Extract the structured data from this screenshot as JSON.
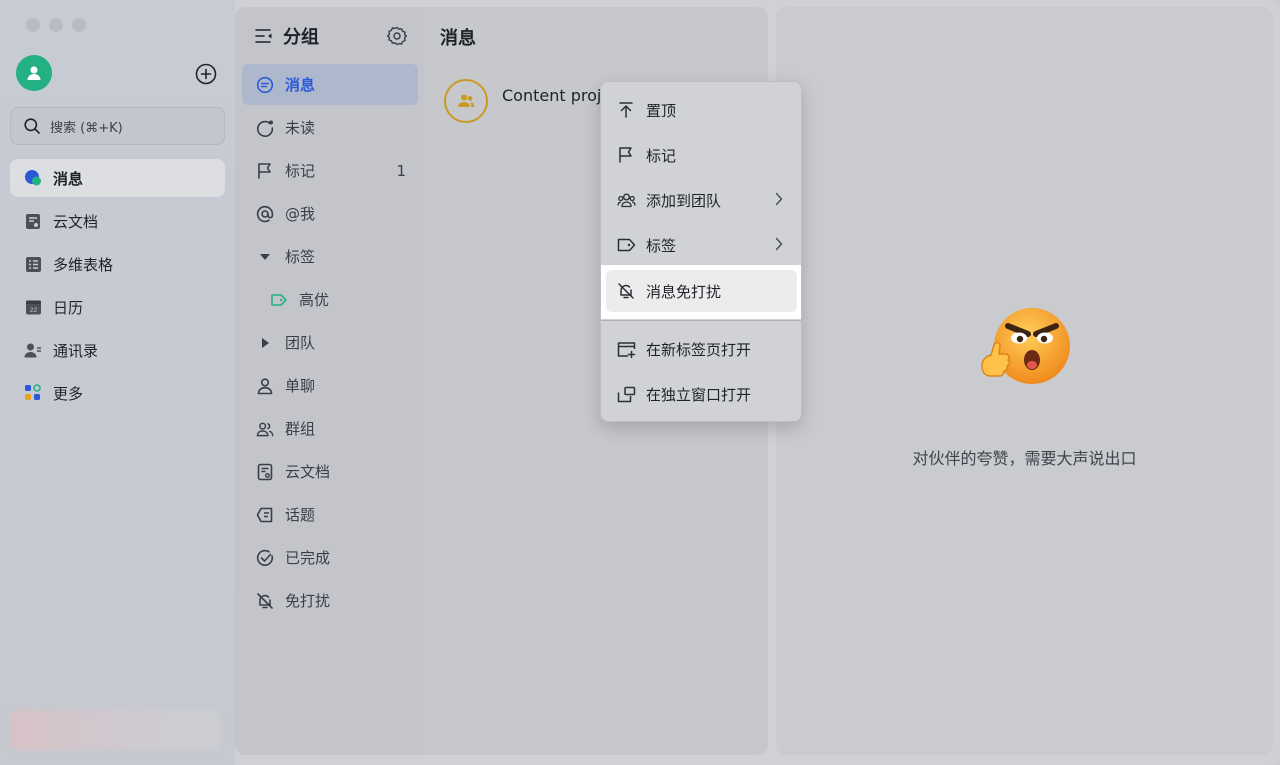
{
  "sidebar": {
    "search_placeholder": "搜索 (⌘+K)",
    "items": [
      {
        "label": "消息",
        "icon": "chat-bubble-icon",
        "active": true
      },
      {
        "label": "云文档",
        "icon": "doc-icon"
      },
      {
        "label": "多维表格",
        "icon": "table-icon"
      },
      {
        "label": "日历",
        "icon": "calendar-icon",
        "calendar_day": "22"
      },
      {
        "label": "通讯录",
        "icon": "contacts-icon"
      },
      {
        "label": "更多",
        "icon": "apps-icon"
      }
    ]
  },
  "groups": {
    "title": "分组",
    "items": [
      {
        "label": "消息",
        "icon": "chat-icon",
        "active": true
      },
      {
        "label": "未读",
        "icon": "unread-icon"
      },
      {
        "label": "标记",
        "icon": "flag-icon",
        "count": "1"
      },
      {
        "label": "@我",
        "icon": "at-icon"
      },
      {
        "label": "标签",
        "icon": "caret-down-icon"
      },
      {
        "label": "高优",
        "icon": "tag-icon",
        "sub": true
      },
      {
        "label": "团队",
        "icon": "caret-right-icon"
      },
      {
        "label": "单聊",
        "icon": "person-icon"
      },
      {
        "label": "群组",
        "icon": "group-icon"
      },
      {
        "label": "云文档",
        "icon": "doc-icon"
      },
      {
        "label": "话题",
        "icon": "topic-icon"
      },
      {
        "label": "已完成",
        "icon": "done-icon"
      },
      {
        "label": "免打扰",
        "icon": "mute-icon"
      }
    ]
  },
  "messages": {
    "title": "消息",
    "chat_name": "Content proje"
  },
  "context_menu": {
    "items": [
      {
        "label": "置顶",
        "icon": "pin-top-icon"
      },
      {
        "label": "标记",
        "icon": "flag-icon"
      },
      {
        "label": "添加到团队",
        "icon": "team-icon",
        "submenu": true
      },
      {
        "label": "标签",
        "icon": "tag-icon",
        "submenu": true
      },
      {
        "label": "消息免打扰",
        "icon": "mute-icon",
        "highlighted": true
      },
      {
        "label": "在新标签页打开",
        "icon": "new-tab-icon"
      },
      {
        "label": "在独立窗口打开",
        "icon": "new-window-icon"
      }
    ]
  },
  "empty_state": {
    "caption": "对伙伴的夸赞，需要大声说出口"
  },
  "colors": {
    "accent": "#2c5ad7",
    "avatar_green": "#23b083",
    "tag_green": "#23b083",
    "chat_avatar_ring": "#c99a25"
  }
}
